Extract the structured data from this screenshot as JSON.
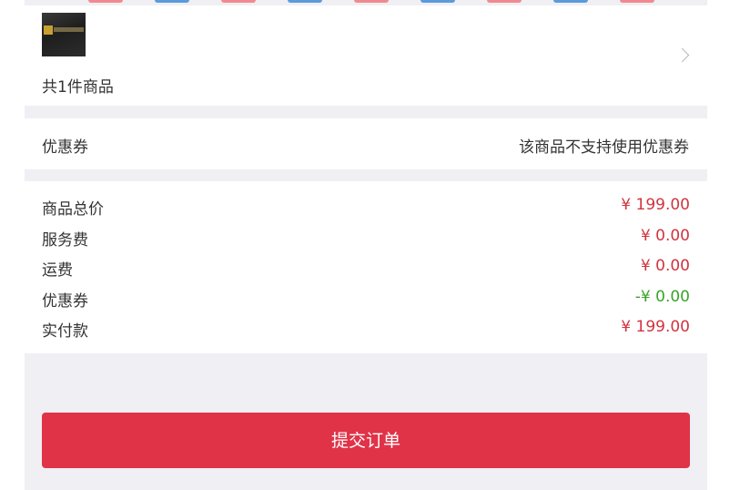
{
  "colors": {
    "price": "#d0343f",
    "discount": "#3aa32a",
    "submit_bg": "#e03348",
    "page_bg": "#efeff4"
  },
  "goods": {
    "count_text": "共1件商品",
    "thumbnail_icon": "product-thumbnail"
  },
  "coupon": {
    "label": "优惠券",
    "value": "该商品不支持使用优惠券"
  },
  "summary": {
    "rows": [
      {
        "label": "商品总价",
        "value": "¥ 199.00"
      },
      {
        "label": "服务费",
        "value": "¥ 0.00"
      },
      {
        "label": "运费",
        "value": "¥ 0.00"
      },
      {
        "label": "优惠券",
        "value": "-¥ 0.00"
      },
      {
        "label": "实付款",
        "value": "¥ 199.00"
      }
    ]
  },
  "submit": {
    "label": "提交订单"
  }
}
